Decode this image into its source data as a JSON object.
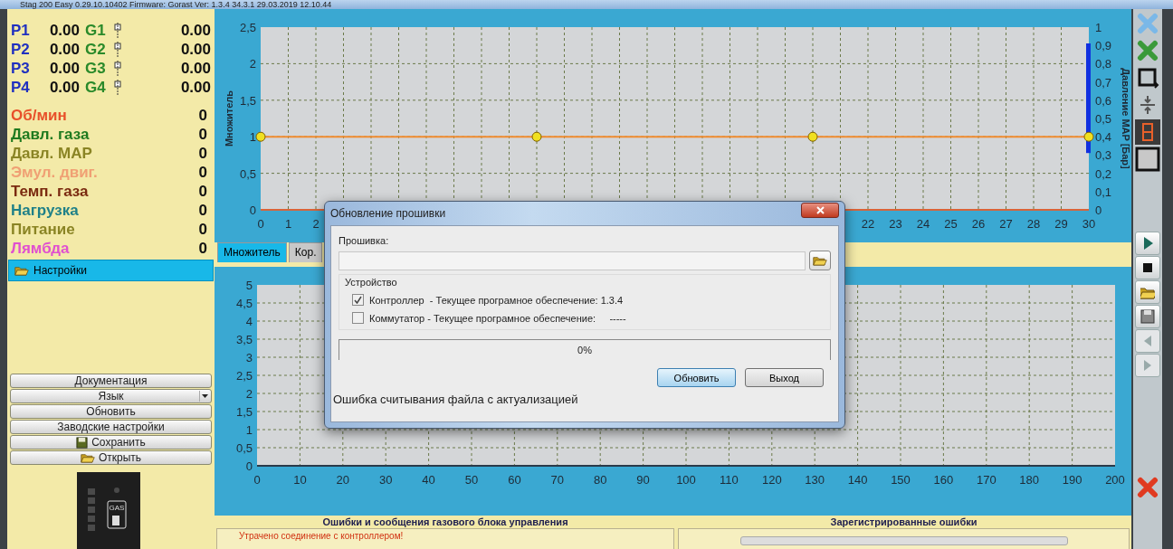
{
  "window": {
    "title": "Stag 200 Easy 0.29.10.10402 Firmware: Gorast  Ver: 1.3.4  34.3.1  29.03.2019 12.10.44"
  },
  "readings": [
    {
      "pressure_label": "P1",
      "pressure_value": "0.00",
      "injector_label": "G1",
      "injector_value": "0.00"
    },
    {
      "pressure_label": "P2",
      "pressure_value": "0.00",
      "injector_label": "G2",
      "injector_value": "0.00"
    },
    {
      "pressure_label": "P3",
      "pressure_value": "0.00",
      "injector_label": "G3",
      "injector_value": "0.00"
    },
    {
      "pressure_label": "P4",
      "pressure_value": "0.00",
      "injector_label": "G4",
      "injector_value": "0.00"
    }
  ],
  "parameters": [
    {
      "label": "Об/мин",
      "value": "0",
      "color": "#e8502a"
    },
    {
      "label": "Давл. газа",
      "value": "0",
      "color": "#1f7a1f"
    },
    {
      "label": "Давл. MAP",
      "value": "0",
      "color": "#8a8424"
    },
    {
      "label": "Эмул. двиг.",
      "value": "0",
      "color": "#f0a074"
    },
    {
      "label": "Темп. газа",
      "value": "0",
      "color": "#7a2a10"
    },
    {
      "label": "Нагрузка",
      "value": "0",
      "color": "#1f8088"
    },
    {
      "label": "Питание",
      "value": "0",
      "color": "#8a8424"
    },
    {
      "label": "Лямбда",
      "value": "0",
      "color": "#e050d0"
    }
  ],
  "tree": [
    {
      "label": "Настройки",
      "selected": true
    }
  ],
  "side_buttons": [
    {
      "label": "Документация",
      "kind": "button"
    },
    {
      "label": "Язык",
      "kind": "dropdown"
    },
    {
      "label": "Обновить",
      "kind": "button"
    },
    {
      "label": "Заводские настройки",
      "kind": "button"
    },
    {
      "label": "Сохранить",
      "kind": "save"
    },
    {
      "label": "Открыть",
      "kind": "open"
    }
  ],
  "device_panel": {
    "label": "GAS"
  },
  "top_chart": {
    "chart_data": {
      "type": "line",
      "ylabel": "Множитель",
      "x": [
        0,
        10,
        20,
        30
      ],
      "xlim": [
        0,
        30
      ],
      "ylim": [
        0,
        2.5
      ],
      "xticks": [
        0,
        1,
        2,
        22,
        23,
        24,
        25,
        26,
        27,
        28,
        29,
        30
      ],
      "yticks": [
        {
          "value": 0,
          "label": "0"
        },
        {
          "value": 0.5,
          "label": "0,5"
        },
        {
          "value": 1,
          "label": "1"
        },
        {
          "value": 1.5,
          "label": "1,5"
        },
        {
          "value": 2,
          "label": "2"
        },
        {
          "value": 2.5,
          "label": "2,5"
        }
      ],
      "series": [
        {
          "color": "#f08c30",
          "marker": "circle",
          "values": [
            1,
            1,
            1,
            1
          ]
        }
      ],
      "grid": true,
      "y2label": "Давление MAP [Бар]",
      "y2lim": [
        0,
        1
      ],
      "y2ticks": [
        {
          "value": 0,
          "label": "0"
        },
        {
          "value": 0.1,
          "label": "0,1"
        },
        {
          "value": 0.2,
          "label": "0,2"
        },
        {
          "value": 0.3,
          "label": "0,3"
        },
        {
          "value": 0.4,
          "label": "0,4"
        },
        {
          "value": 0.5,
          "label": "0,5"
        },
        {
          "value": 0.6,
          "label": "0,6"
        },
        {
          "value": 0.7,
          "label": "0,7"
        },
        {
          "value": 0.8,
          "label": "0,8"
        },
        {
          "value": 0.9,
          "label": "0,9"
        },
        {
          "value": 1,
          "label": "1"
        }
      ]
    }
  },
  "tabs": [
    {
      "label": "Множитель",
      "selected": true
    },
    {
      "label": "Кор.",
      "selected": false
    }
  ],
  "bottom_chart": {
    "chart_data": {
      "type": "line",
      "grid": true,
      "xlim": [
        0,
        200
      ],
      "ylim": [
        0,
        5
      ],
      "xticks": [
        0,
        10,
        20,
        30,
        40,
        50,
        60,
        70,
        80,
        90,
        100,
        110,
        120,
        130,
        140,
        150,
        160,
        170,
        180,
        190,
        200
      ],
      "yticks": [
        {
          "value": 0,
          "label": "0"
        },
        {
          "value": 0.5,
          "label": "0,5"
        },
        {
          "value": 1,
          "label": "1"
        },
        {
          "value": 1.5,
          "label": "1,5"
        },
        {
          "value": 2,
          "label": "2"
        },
        {
          "value": 2.5,
          "label": "2,5"
        },
        {
          "value": 3,
          "label": "3"
        },
        {
          "value": 3.5,
          "label": "3,5"
        },
        {
          "value": 4,
          "label": "4"
        },
        {
          "value": 4.5,
          "label": "4,5"
        },
        {
          "value": 5,
          "label": "5"
        }
      ]
    }
  },
  "toolbar_top": [
    {
      "kind": "close-light"
    },
    {
      "kind": "close-green"
    },
    {
      "kind": "frame"
    },
    {
      "kind": "compress"
    },
    {
      "kind": "digit"
    },
    {
      "kind": "blank"
    }
  ],
  "toolbar_bottom": [
    {
      "kind": "play",
      "disabled": false
    },
    {
      "kind": "stop",
      "disabled": false
    },
    {
      "kind": "open",
      "disabled": false
    },
    {
      "kind": "save",
      "disabled": false
    },
    {
      "kind": "prev",
      "disabled": true
    },
    {
      "kind": "next",
      "disabled": true
    }
  ],
  "toolbar_exit": {
    "kind": "close-red"
  },
  "error_panels": [
    {
      "title": "Ошибки и сообщения газового блока управления",
      "messages": [
        "Утрачено соединение с контроллером!"
      ]
    },
    {
      "title": "Зарегистрированные ошибки"
    }
  ],
  "dialog": {
    "title": "Обновление прошивки",
    "file_label": "Прошивка:",
    "group_label": "Устройство",
    "devices": [
      {
        "label": "Контроллер  - Текущее програмное обеспечение: 1.3.4",
        "checked": true
      },
      {
        "label": "Коммутатор - Текущее програмное обеспечение:     -----",
        "checked": false
      }
    ],
    "progress": {
      "level": 0,
      "text": "0%"
    },
    "buttons": [
      {
        "label": "Обновить",
        "selected": true
      },
      {
        "label": "Выход",
        "selected": false
      }
    ],
    "status": "Ошибка считывания файла с актуализацией"
  }
}
